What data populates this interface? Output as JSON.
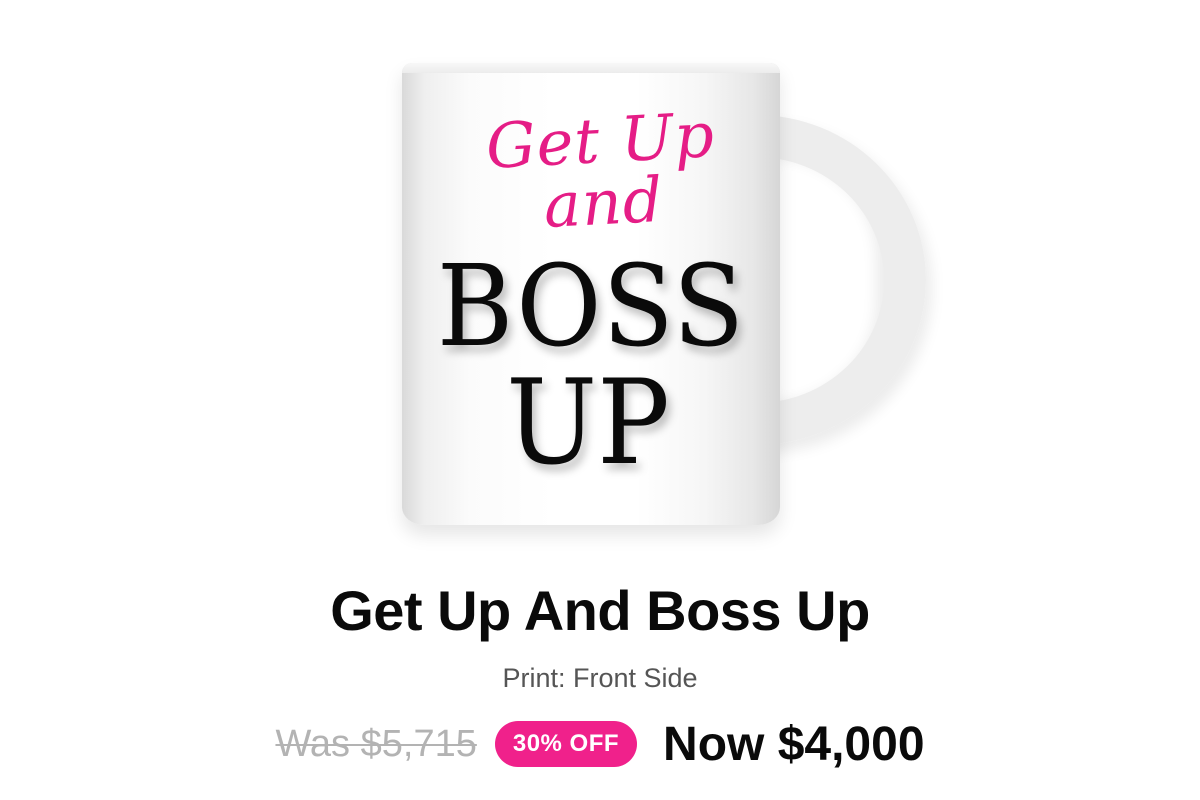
{
  "product": {
    "image": {
      "script_text": "Get Up and",
      "main_text_line1": "BOSS",
      "main_text_line2": "UP",
      "accent_color": "#e51d86"
    },
    "title": "Get Up And Boss Up",
    "print_option": "Print: Front Side",
    "pricing": {
      "was": "Was $5,715",
      "discount": "30% OFF",
      "now": "Now $4,000",
      "badge_color": "#f0218b"
    }
  }
}
